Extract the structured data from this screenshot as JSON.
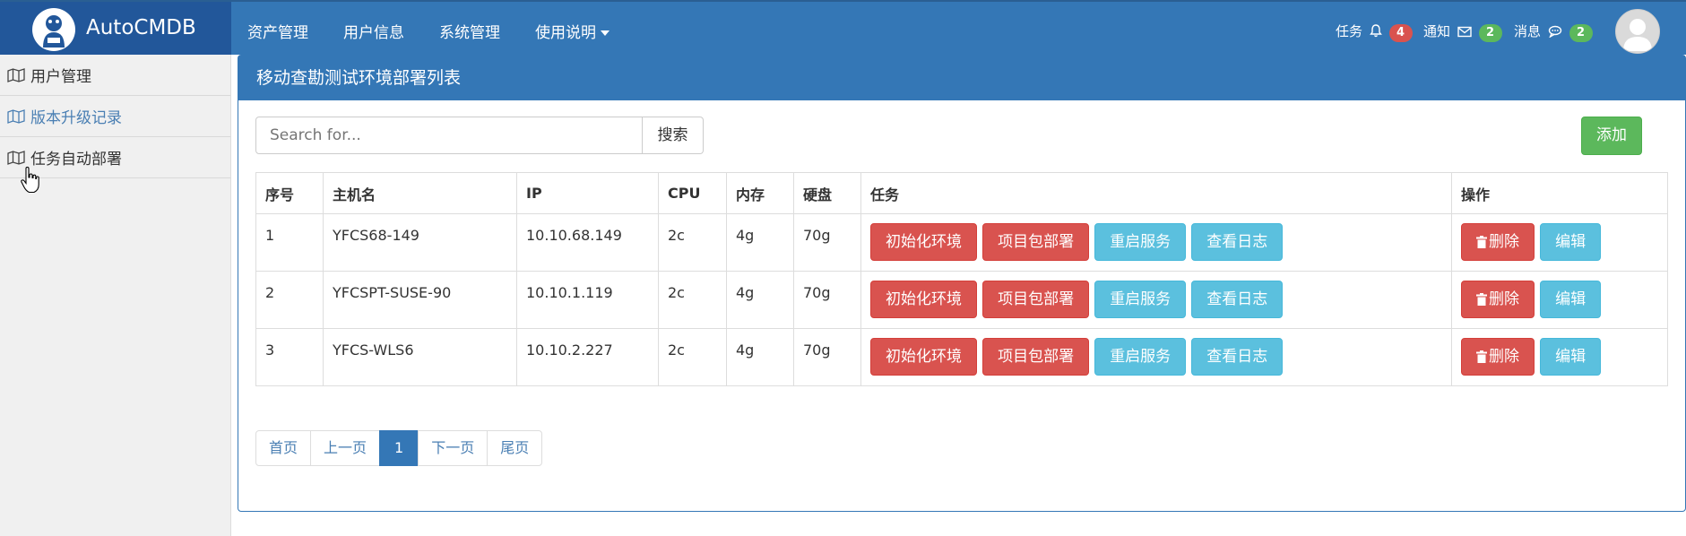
{
  "brand": {
    "name": "AutoCMDB"
  },
  "topnav": [
    {
      "label": "资产管理"
    },
    {
      "label": "用户信息"
    },
    {
      "label": "系统管理"
    },
    {
      "label": "使用说明"
    }
  ],
  "notifications": [
    {
      "label": "任务",
      "icon": "bell-icon",
      "count": "4",
      "color": "#d9534f"
    },
    {
      "label": "通知",
      "icon": "envelope-icon",
      "count": "2",
      "color": "#5cb85c"
    },
    {
      "label": "消息",
      "icon": "comment-icon",
      "count": "2",
      "color": "#5cb85c"
    }
  ],
  "sidebar": {
    "items": [
      {
        "label": "用户管理",
        "icon": "map-icon"
      },
      {
        "label": "版本升级记录",
        "icon": "map-icon",
        "active": true
      },
      {
        "label": "任务自动部署",
        "icon": "map-icon"
      }
    ]
  },
  "panel": {
    "title": "移动查勘测试环境部署列表"
  },
  "search": {
    "placeholder": "Search for...",
    "button": "搜索"
  },
  "actions": {
    "add": "添加"
  },
  "table": {
    "headers": [
      "序号",
      "主机名",
      "IP",
      "CPU",
      "内存",
      "硬盘",
      "任务",
      "操作"
    ],
    "task_buttons": [
      "初始化环境",
      "项目包部署",
      "重启服务",
      "查看日志"
    ],
    "op_buttons": [
      "删除",
      "编辑"
    ],
    "rows": [
      {
        "id": "1",
        "hostname": "YFCS68-149",
        "ip": "10.10.68.149",
        "cpu": "2c",
        "mem": "4g",
        "disk": "70g"
      },
      {
        "id": "2",
        "hostname": "YFCSPT-SUSE-90",
        "ip": "10.10.1.119",
        "cpu": "2c",
        "mem": "4g",
        "disk": "70g"
      },
      {
        "id": "3",
        "hostname": "YFCS-WLS6",
        "ip": "10.10.2.227",
        "cpu": "2c",
        "mem": "4g",
        "disk": "70g"
      }
    ]
  },
  "pagination": {
    "first": "首页",
    "prev": "上一页",
    "current": "1",
    "next": "下一页",
    "last": "尾页"
  }
}
